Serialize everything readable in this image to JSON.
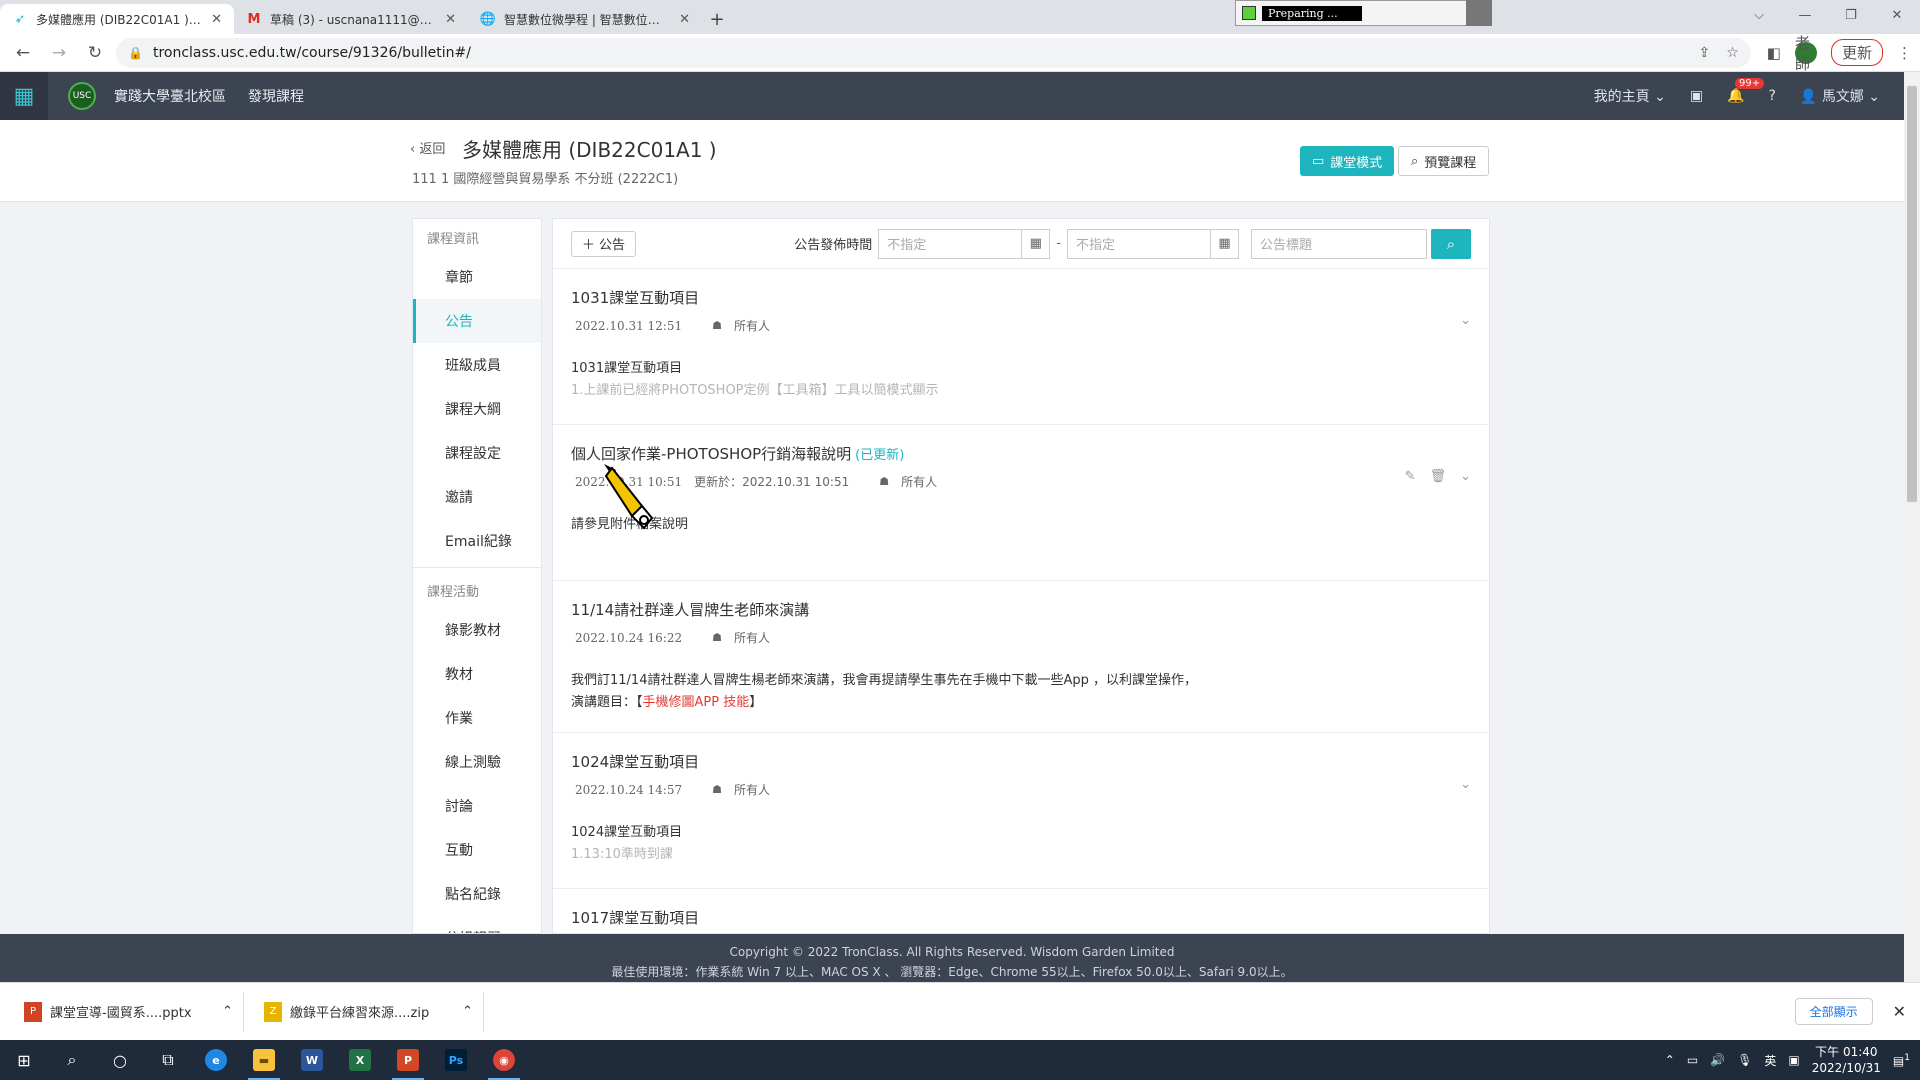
{
  "browser": {
    "tabs": [
      {
        "title": "多媒體應用 (DIB22C01A1 ) - 實踐",
        "active": true
      },
      {
        "title": "草稿 (3) - uscnana1111@gmail",
        "active": false
      },
      {
        "title": "智慧數位微學程 | 智慧數位平台",
        "active": false
      }
    ],
    "preparing": "Preparing ...",
    "url": "tronclass.usc.edu.tw/course/91326/bulletin#/",
    "profile_badge": "老師",
    "update_label": "更新"
  },
  "appbar": {
    "links": [
      "實踐大學臺北校區",
      "發現課程"
    ],
    "my_home": "我的主頁",
    "notif_badge": "99+",
    "user_name": "馬文娜"
  },
  "course": {
    "back": "返回",
    "title": "多媒體應用 (DIB22C01A1 )",
    "subtitle": "111 1 國際經營與貿易學系 不分班 (2222C1)",
    "class_mode": "課堂模式",
    "preview": "預覽課程"
  },
  "sidebar": {
    "group1": "課程資訊",
    "items1": [
      "章節",
      "公告",
      "班級成員",
      "課程大綱",
      "課程設定",
      "邀請",
      "Email紀錄"
    ],
    "group2": "課程活動",
    "items2": [
      "錄影教材",
      "教材",
      "作業",
      "線上測驗",
      "討論",
      "互動",
      "點名紀錄",
      "分組報習"
    ]
  },
  "toolbar": {
    "add": "公告",
    "date_label": "公告發佈時間",
    "date_placeholder": "不指定",
    "search_placeholder": "公告標題"
  },
  "posts": [
    {
      "title": "1031課堂互動項目",
      "date": "2022.10.31 12:51",
      "audience": "所有人",
      "body1": "1031課堂互動項目",
      "body2": "1.上課前已經將PHOTOSHOP定例【工具箱】工具以簡模式顯示"
    },
    {
      "title": "個人回家作業-PHOTOSHOP行銷海報說明",
      "updated": "(已更新)",
      "date": "2022.10.31 10:51",
      "updated_at": "更新於：2022.10.31 10:51",
      "audience": "所有人",
      "body1": "請參見附件檔案說明"
    },
    {
      "title": "11/14請社群達人冒牌生老師來演講",
      "date": "2022.10.24 16:22",
      "audience": "所有人",
      "body1": "我們訂11/14請社群達人冒牌生楊老師來演講，我會再提請學生事先在手機中下載一些App ，以利課堂操作，",
      "body2_prefix": "演講題目：【",
      "body2_red": "手機修圖APP 技能",
      "body2_suffix": "】"
    },
    {
      "title": "1024課堂互動項目",
      "date": "2022.10.24 14:57",
      "audience": "所有人",
      "body1": "1024課堂互動項目",
      "body2": "1.13:10準時到課"
    },
    {
      "title": "1017課堂互動項目"
    }
  ],
  "footer": {
    "line1": "Copyright © 2022 TronClass. All Rights Reserved. Wisdom Garden Limited",
    "line2": "最佳使用環境：作業系統 Win 7 以上、MAC OS X 、 瀏覽器：Edge、Chrome 55以上、Firefox 50.0以上、Safari 9.0以上。"
  },
  "downloads": {
    "items": [
      "課堂宣導-國貿系....pptx",
      "繳錄平台練習來源....zip"
    ],
    "show_all": "全部顯示"
  },
  "taskbar": {
    "ime": "英",
    "time": "下午 01:40",
    "date": "2022/10/31",
    "notify_count": "1"
  }
}
